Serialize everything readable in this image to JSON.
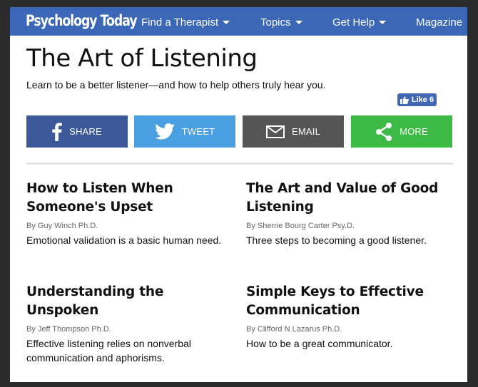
{
  "header": {
    "logo": "Psychology Today",
    "nav": [
      {
        "label": "Find a Therapist",
        "has_caret": true
      },
      {
        "label": "Topics",
        "has_caret": true
      },
      {
        "label": "Get Help",
        "has_caret": true
      },
      {
        "label": "Magazine",
        "has_caret": false
      }
    ]
  },
  "page": {
    "title": "The Art of Listening",
    "subtitle": "Learn to be a better listener—and how to help others truly hear you."
  },
  "like": {
    "label": "Like 6",
    "icon": "thumbs-up-icon"
  },
  "share_buttons": [
    {
      "label": "SHARE",
      "icon": "facebook-icon",
      "color": "#3b5998"
    },
    {
      "label": "TWEET",
      "icon": "twitter-icon",
      "color": "#4a9fe0"
    },
    {
      "label": "EMAIL",
      "icon": "envelope-icon",
      "color": "#555555"
    },
    {
      "label": "MORE",
      "icon": "share-icon",
      "color": "#3dba45"
    }
  ],
  "articles": [
    {
      "title": "How to Listen When Someone's Upset",
      "author": "By Guy Winch Ph.D.",
      "description": "Emotional validation is a basic human need."
    },
    {
      "title": "The Art and Value of Good Listening",
      "author": "By Sherrie Bourg Carter Psy.D.",
      "description": "Three steps to becoming a good listener."
    },
    {
      "title": "Understanding the Unspoken",
      "author": "By Jeff Thompson Ph.D.",
      "description": "Effective listening relies on nonverbal communication and aphorisms."
    },
    {
      "title": "Simple Keys to Effective Communication",
      "author": "By Clifford N Lazarus Ph.D.",
      "description": "How to be a great communicator."
    }
  ],
  "colors": {
    "header_bg": "#3b67b6",
    "like_bg": "#4267b2"
  }
}
